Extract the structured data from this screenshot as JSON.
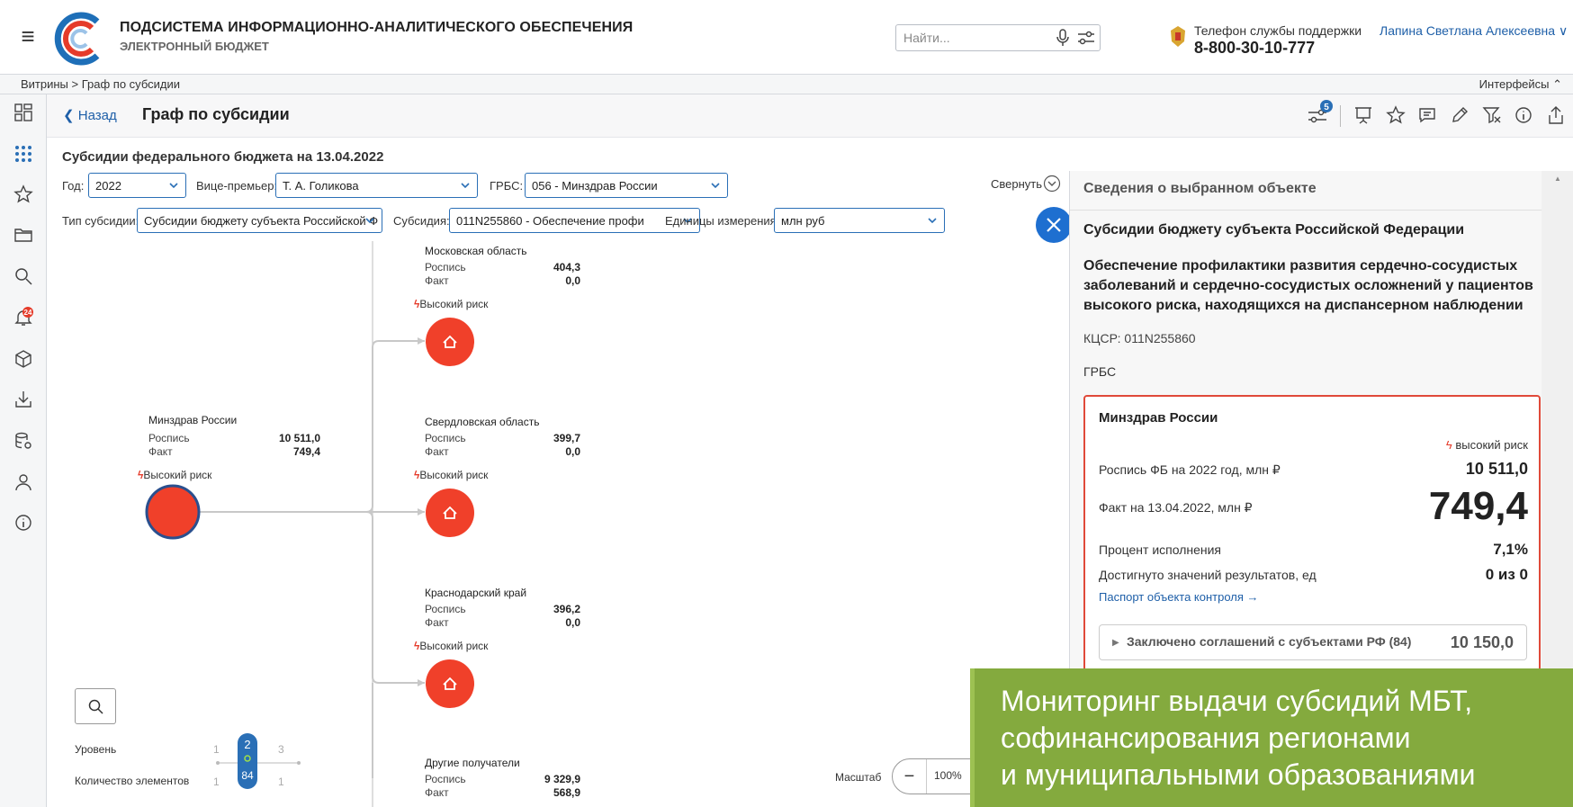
{
  "header": {
    "app_title": "ПОДСИСТЕМА ИНФОРМАЦИОННО-АНАЛИТИЧЕСКОГО ОБЕСПЕЧЕНИЯ",
    "app_subtitle": "ЭЛЕКТРОННЫЙ БЮДЖЕТ",
    "search_placeholder": "Найти...",
    "support_label": "Телефон службы поддержки",
    "support_phone": "8-800-30-10-777",
    "user_name": "Лапина Светлана Алексеевна ∨"
  },
  "breadcrumb": {
    "path": "Витрины > Граф по субсидии",
    "interfaces": "Интерфейсы ⌃"
  },
  "leftnav": {
    "notifications_badge": "24"
  },
  "page": {
    "back_label": "Назад",
    "title": "Граф по субсидии",
    "filters_badge": "5"
  },
  "main": {
    "section_title": "Субсидии федерального бюджета на 13.04.2022",
    "collapse_label": "Свернуть",
    "filters": {
      "year_label": "Год:",
      "year_value": "2022",
      "vice_label": "Вице-премьер:",
      "vice_value": "Т. А. Голикова",
      "grbs_label": "ГРБС:",
      "grbs_value": "056 - Минздрав России",
      "type_label": "Тип субсидии:",
      "type_value": "Субсидии бюджету субъекта Российской Ф",
      "subsidy_label": "Субсидия:",
      "subsidy_value": "011N255860 - Обеспечение профи",
      "units_label": "Единицы измерения:",
      "units_value": "млн руб"
    }
  },
  "graph": {
    "plan_label": "Роспись",
    "fact_label": "Факт",
    "risk_label": "Высокий риск",
    "root": {
      "name": "Минздрав России",
      "plan": "10 511,0",
      "fact": "749,4"
    },
    "children": [
      {
        "name": "Московская область",
        "plan": "404,3",
        "fact": "0,0",
        "risk": true
      },
      {
        "name": "Свердловская область",
        "plan": "399,7",
        "fact": "0,0",
        "risk": true
      },
      {
        "name": "Краснодарский край",
        "plan": "396,2",
        "fact": "0,0",
        "risk": true
      },
      {
        "name": "Другие получатели",
        "plan": "9 329,9",
        "fact": "568,9",
        "risk": false
      }
    ]
  },
  "controls": {
    "level_label": "Уровень",
    "count_label": "Количество элементов",
    "level_min": "1",
    "level_value": "2",
    "level_max": "3",
    "count_min": "1",
    "count_value": "84",
    "count_max": "1",
    "scale_label": "Масштаб",
    "scale_value": "100%"
  },
  "side_panel": {
    "title": "Сведения о выбранном объекте",
    "subsidy_type": "Субсидии бюджету субъекта Российской Федерации",
    "description": "Обеспечение профилактики развития сердечно-сосудистых заболеваний и сердечно-сосудистых осложнений у пациентов высокого риска, находящихся на диспансерном наблюдении",
    "kcsr": "КЦСР: 011N255860",
    "grbs_label": "ГРБС",
    "card": {
      "org": "Минздрав России",
      "risk": "высокий риск",
      "plan_label": "Роспись ФБ на 2022 год, млн ₽",
      "plan_value": "10 511,0",
      "fact_label": "Факт на 13.04.2022, млн ₽",
      "fact_value": "749,4",
      "pct_label": "Процент исполнения",
      "pct_value": "7,1%",
      "results_label": "Достигнуто значений результатов, ед",
      "results_value": "0 из 0",
      "passport_link": "Паспорт объекта контроля →",
      "agreements_label": "Заключено соглашений с субъектами РФ (84)",
      "agreements_value": "10 150,0"
    }
  },
  "promo": {
    "line1": "Мониторинг выдачи субсидий МБТ,",
    "line2": "софинансирования регионами",
    "line3": "и муниципальными образованиями"
  },
  "colors": {
    "accent": "#2a6fb6",
    "risk": "#f0402a",
    "promo": "#84aa3e"
  }
}
